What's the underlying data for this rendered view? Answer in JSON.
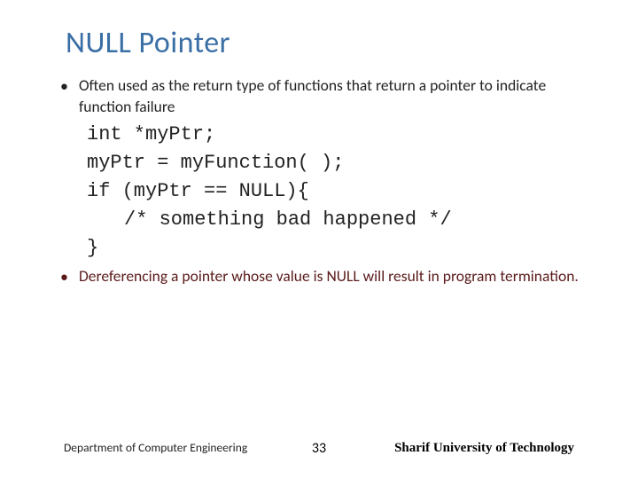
{
  "title": "NULL Pointer",
  "bullets": {
    "first": "Often used as the return type of functions that return a pointer to indicate function failure",
    "second": "Dereferencing a pointer whose value is NULL will result in program termination."
  },
  "code": {
    "l1": "int *myPtr;",
    "l2": "myPtr = myFunction( );",
    "l3": "if (myPtr == NULL){",
    "l4": "/* something bad happened */",
    "l5": "}"
  },
  "footer": {
    "left": "Department of Computer Engineering",
    "page": "33",
    "right": "Sharif University of Technology"
  }
}
